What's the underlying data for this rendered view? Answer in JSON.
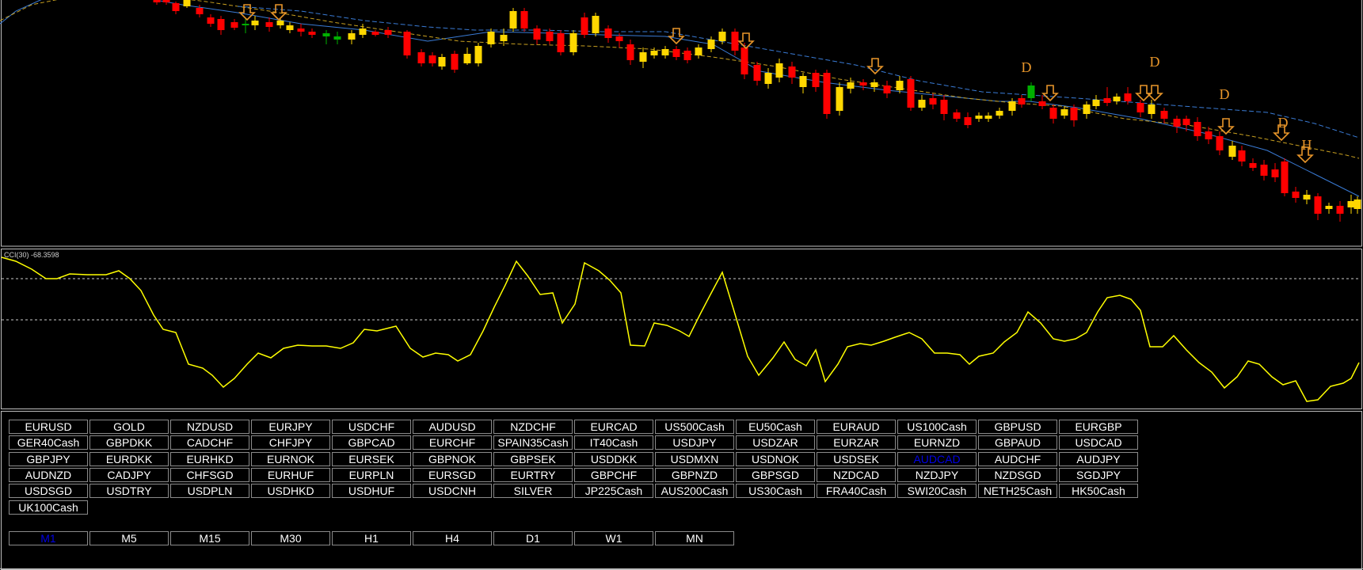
{
  "colors": {
    "bull_candle": "#FFD700",
    "bear_candle": "#FF0000",
    "doji_candle": "#00B000",
    "ma_fast": "#3A7BD5",
    "ma_slow": "#C8A020",
    "cci_line": "#FFFF00",
    "arrow_signal": "#E8962A",
    "level_line": "#CCCCCC",
    "panel_border": "#BFBFBF",
    "button_border": "#8A8A8A",
    "active_button_text": "#0000E6"
  },
  "indicator": {
    "label": "CCI(30) -68.3598"
  },
  "signals": {
    "arrow_icon": "down-arrow-icon",
    "markers": [
      "D",
      "D",
      "D",
      "D",
      "H"
    ]
  },
  "symbols": [
    [
      "EURUSD",
      "GOLD",
      "NZDUSD",
      "EURJPY",
      "USDCHF",
      "AUDUSD",
      "NZDCHF",
      "EURCAD",
      "US500Cash",
      "EU50Cash",
      "EURAUD",
      "US100Cash",
      "GBPUSD",
      "EURGBP"
    ],
    [
      "GER40Cash",
      "GBPDKK",
      "CADCHF",
      "CHFJPY",
      "GBPCAD",
      "EURCHF",
      "SPAIN35Cash",
      "IT40Cash",
      "USDJPY",
      "USDZAR",
      "EURZAR",
      "EURNZD",
      "GBPAUD",
      "USDCAD"
    ],
    [
      "GBPJPY",
      "EURDKK",
      "EURHKD",
      "EURNOK",
      "EURSEK",
      "GBPNOK",
      "GBPSEK",
      "USDDKK",
      "USDMXN",
      "USDNOK",
      "USDSEK",
      "AUDCAD",
      "AUDCHF",
      "AUDJPY"
    ],
    [
      "AUDNZD",
      "CADJPY",
      "CHFSGD",
      "EURHUF",
      "EURPLN",
      "EURSGD",
      "EURTRY",
      "GBPCHF",
      "GBPNZD",
      "GBPSGD",
      "NZDCAD",
      "NZDJPY",
      "NZDSGD",
      "SGDJPY"
    ],
    [
      "USDSGD",
      "USDTRY",
      "USDPLN",
      "USDHKD",
      "USDHUF",
      "USDCNH",
      "SILVER",
      "JP225Cash",
      "AUS200Cash",
      "US30Cash",
      "FRA40Cash",
      "SWI20Cash",
      "NETH25Cash",
      "HK50Cash"
    ],
    [
      "UK100Cash"
    ]
  ],
  "active_symbol": "AUDCAD",
  "timeframes": [
    "M1",
    "M5",
    "M15",
    "M30",
    "H1",
    "H4",
    "D1",
    "W1",
    "MN"
  ],
  "active_timeframe": "M1"
}
